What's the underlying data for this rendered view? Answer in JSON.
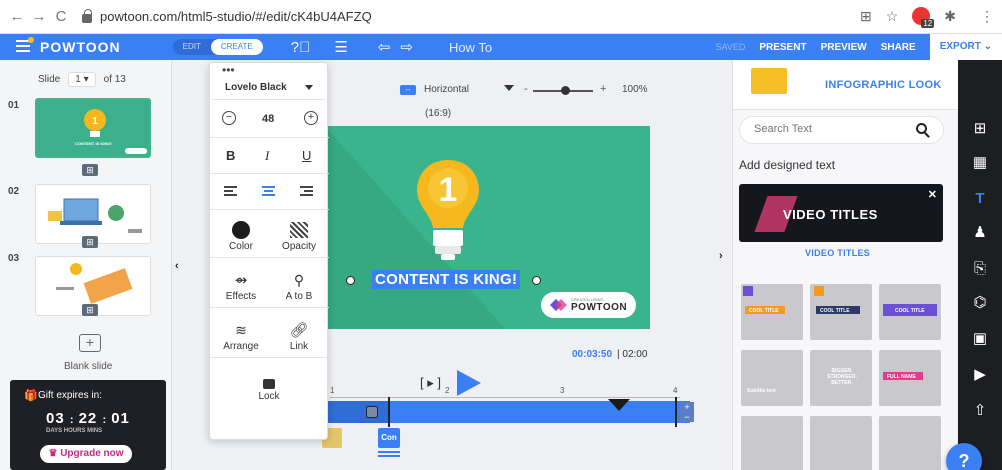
{
  "browser": {
    "url": "powtoon.com/html5-studio/#/edit/cK4bU4AFZQ",
    "ext_badge": "12"
  },
  "topbar": {
    "logo": "POWTOON",
    "mode_edit": "EDIT",
    "mode_create": "CREATE",
    "title": "How To",
    "saved": "SAVED",
    "present": "PRESENT",
    "preview": "PREVIEW",
    "share": "SHARE",
    "export": "EXPORT"
  },
  "slides": {
    "label": "Slide",
    "current": "1",
    "total": "of 13",
    "items": [
      {
        "num": "01",
        "caption": "CONTENT IS KING!"
      },
      {
        "num": "02"
      },
      {
        "num": "03"
      }
    ],
    "blank_label": "Blank slide"
  },
  "gift": {
    "title": "Gift expires in:",
    "days": "03",
    "hours": "22",
    "mins": "01",
    "labels": "DAYS   HOURS   MINS",
    "upgrade": "Upgrade now"
  },
  "canvas": {
    "orientation": "Horizontal",
    "ratio": "(16:9)",
    "zoom": "100%",
    "headline": "CONTENT IS KING!",
    "badge_small": "CREATED USING",
    "badge_brand": "POWTOON",
    "time_current": "00:03:50",
    "time_total": "| 02:00",
    "ticks": [
      "1",
      "2",
      "3",
      "4"
    ],
    "track_label": "Con"
  },
  "format": {
    "font": "Lovelo Black",
    "size": "48",
    "color": "Color",
    "opacity": "Opacity",
    "effects": "Effects",
    "atob": "A to B",
    "arrange": "Arrange",
    "link": "Link",
    "lock": "Lock"
  },
  "right": {
    "head_title": "INFOGRAPHIC LOOK",
    "search_placeholder": "Search Text",
    "subtitle": "Add designed text",
    "banner_text": "VIDEO TITLES",
    "banner_label": "VIDEO TITLES",
    "tiles": [
      {
        "t": "COOL TITLE"
      },
      {
        "t": "COOL TITLE"
      },
      {
        "t": "COOL TITLE"
      },
      {
        "t": "Subtitle text"
      },
      {
        "t": "BIGGER. STRONGER. BETTER."
      },
      {
        "t": "FULL NAME"
      }
    ],
    "help": "?"
  }
}
